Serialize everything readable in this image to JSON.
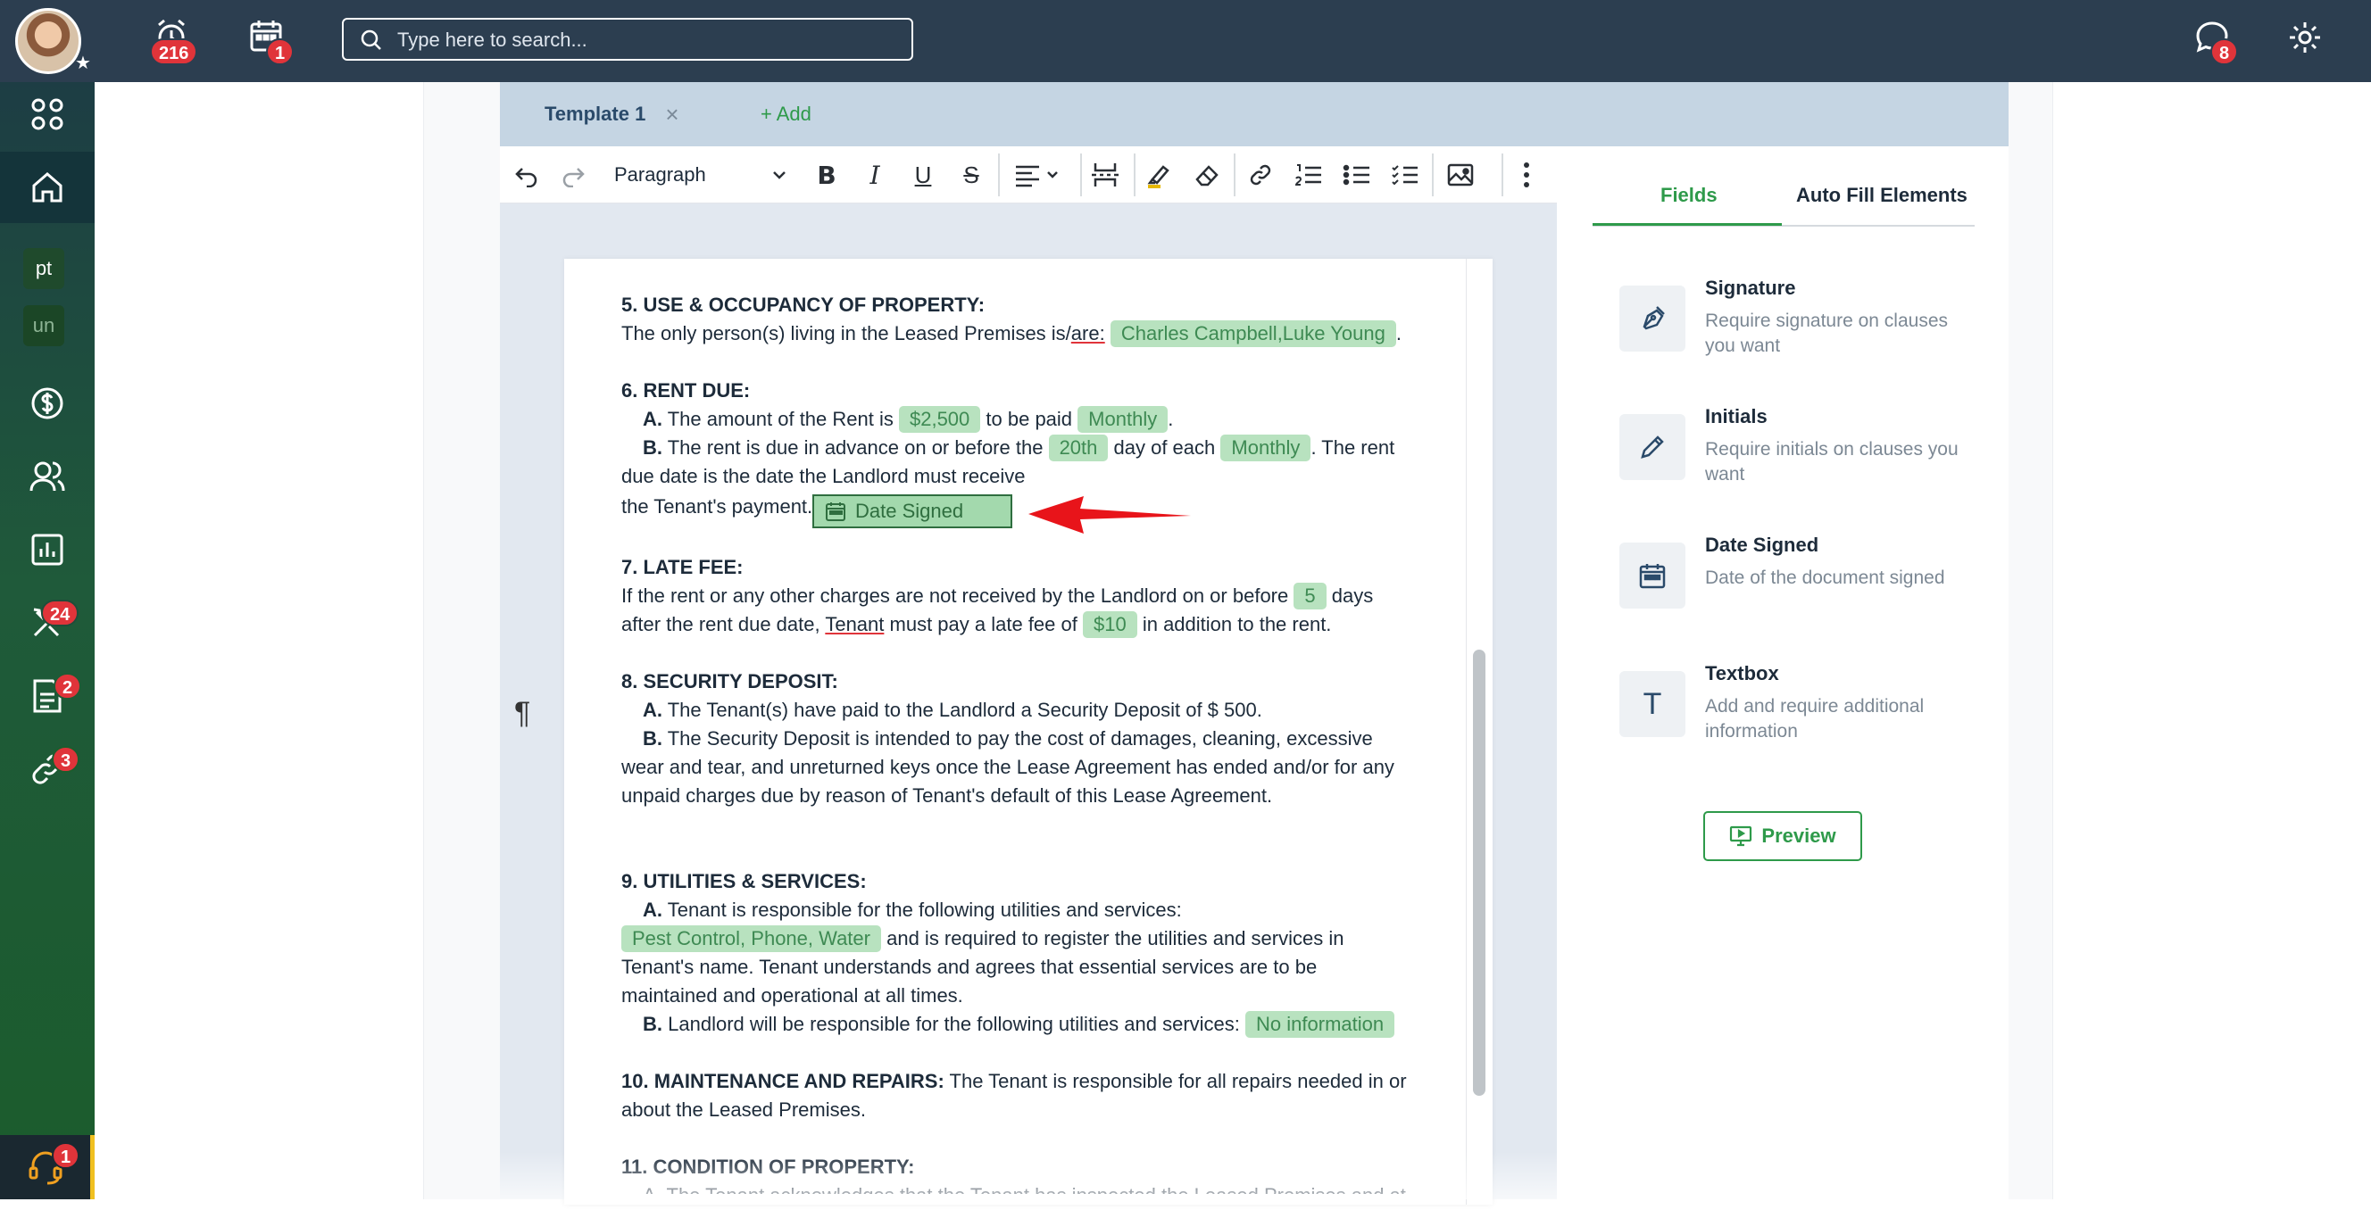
{
  "topbar": {
    "alarm_badge": "216",
    "calendar_badge": "1",
    "search_placeholder": "Type here to search...",
    "chat_badge": "8"
  },
  "sidebar": {
    "workspace_1": "pt",
    "workspace_2": "un",
    "tools_badge": "24",
    "documents_badge": "2",
    "links_badge": "3",
    "support_badge": "1"
  },
  "tabs": {
    "active_label": "Template 1",
    "close": "×",
    "add_label": "+ Add"
  },
  "toolbar": {
    "paragraph_style": "Paragraph"
  },
  "document": {
    "s5_title": "5. USE & OCCUPANCY OF PROPERTY:",
    "s5_text": "The only person(s) living in the Leased Premises is/",
    "s5_are": "are:",
    "s5_chip": "Charles Campbell,Luke Young",
    "s6_title": "6. RENT DUE:",
    "s6_a_label": "A.",
    "s6_a_text1": "The amount of the Rent is",
    "s6_a_chip1": "$2,500",
    "s6_a_text2": "to be paid",
    "s6_a_chip2": "Monthly",
    "s6_b_label": "B.",
    "s6_b_text1": "The rent is due in advance on or before the",
    "s6_b_chip1": "20th",
    "s6_b_text2": "day of each",
    "s6_b_chip2": "Monthly",
    "s6_b_text3": ". The rent",
    "s6_b_line2": "due date is the date the Landlord must receive",
    "s6_b_line3": "the Tenant's payment.",
    "date_chip": "Date Signed",
    "s7_title": "7. LATE FEE:",
    "s7_text1": "If the rent or any other charges are not received by the Landlord on or before",
    "s7_chip1": "5",
    "s7_text2": "days",
    "s7_line2a": "after the rent due date,",
    "s7_tenant": "Tenant",
    "s7_line2b": "must pay a late fee of",
    "s7_chip2": "$10",
    "s7_line2c": "in addition to the rent.",
    "s8_title": "8. SECURITY DEPOSIT:",
    "s8_a_label": "A.",
    "s8_a_text": "The Tenant(s) have paid to the Landlord a Security Deposit of $ 500.",
    "s8_b_label": "B.",
    "s8_b_text": "The Security Deposit is intended to pay the cost of damages, cleaning, excessive",
    "s8_b_line2": "wear and tear, and unreturned keys once the Lease Agreement has ended and/or for any",
    "s8_b_line3": "unpaid charges due by reason of Tenant's default of this Lease Agreement.",
    "s9_title": "9. UTILITIES & SERVICES:",
    "s9_a_label": "A.",
    "s9_a_text": "Tenant is responsible for the following utilities and services:",
    "s9_a_chip": "Pest Control, Phone, Water",
    "s9_a_text2": "and is required to register the utilities and services in",
    "s9_a_line3": "Tenant's name. Tenant understands and agrees that essential services are to be",
    "s9_a_line4": "maintained and operational at all times.",
    "s9_b_label": "B.",
    "s9_b_text": "Landlord will be responsible for the following utilities and services:",
    "s9_b_chip": "No information",
    "s10_title": "10. MAINTENANCE AND REPAIRS:",
    "s10_text": "The Tenant is responsible for all repairs needed in or",
    "s10_line2": "about the Leased Premises.",
    "s11_title": "11. CONDITION OF PROPERTY:",
    "s11_cut": "A. The Tenant acknowledges that the Tenant has inspected the Leased Premises and at"
  },
  "panel": {
    "tab_fields": "Fields",
    "tab_autofill": "Auto Fill Elements",
    "fields": [
      {
        "title": "Signature",
        "desc": "Require signature on clauses you want"
      },
      {
        "title": "Initials",
        "desc": "Require initials on clauses you want"
      },
      {
        "title": "Date Signed",
        "desc": "Date of the document signed"
      },
      {
        "title": "Textbox",
        "desc": "Add and require additional information"
      }
    ],
    "textbox_glyph": "T",
    "preview_label": "Preview"
  },
  "colors": {
    "topbar": "#2c3e50",
    "accent_green": "#2e9a4a",
    "chip_bg": "#b8e2bf",
    "badge_red": "#e0343a",
    "arrow_red": "#e8141a"
  }
}
